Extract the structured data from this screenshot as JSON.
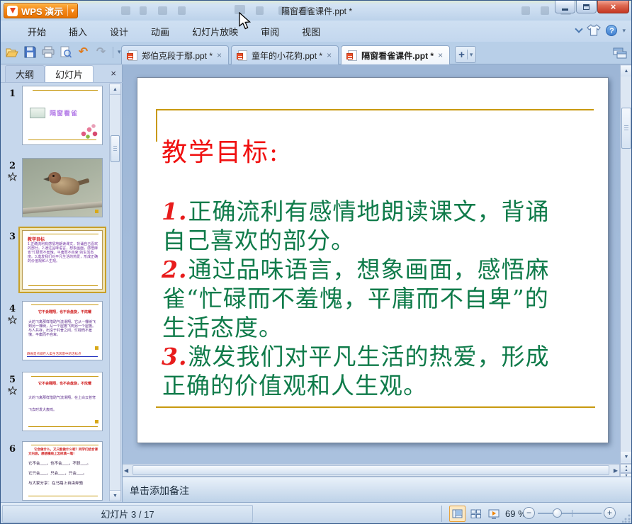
{
  "window": {
    "app_button_label": "WPS 演示",
    "title": "隔窗看雀课件.ppt *"
  },
  "menu": {
    "items": [
      "开始",
      "插入",
      "设计",
      "动画",
      "幻灯片放映",
      "审阅",
      "视图"
    ]
  },
  "doc_tabs": {
    "tabs": [
      {
        "label": "郑伯克段于鄢.ppt *"
      },
      {
        "label": "童年的小花狗.ppt *"
      },
      {
        "label": "隔窗看雀课件.ppt *"
      }
    ]
  },
  "sidebar": {
    "tab_outline": "大纲",
    "tab_slides": "幻灯片",
    "thumbnails": {
      "t1": {
        "num": "1",
        "title": "隔窗看雀"
      },
      "t2": {
        "num": "2"
      },
      "t3": {
        "num": "3",
        "heading": "教学目标",
        "body": "1.正确流利有感情地朗读课文，背诵自己喜欢的部分。2.通过品味语言，想象画面，感悟麻雀“忙碌而不羞愧，平庸而不自卑”的生活态度。3.激发我们对平凡生活的热爱，形成正确的价值观和人生观。"
      },
      "t4": {
        "num": "4",
        "lead": "它不会翱翔，也不会盘旋，不炫耀",
        "body": "大的飞禽那样借助气流滑翔。它从一棵树飞到另一棵树，从一个屋檐飞到另一个屋檐。与人共存，出没于村舍之间，忙碌而不羞愧，平庸而不自卑。",
        "footer": "麻雀是点缀在人类生活风景中的活标点"
      },
      "t5": {
        "num": "5",
        "lead": "它不会翱翔，也不会盘旋，不炫耀",
        "body1": "大的飞禽那样借助气流滑翔，在上白云苍穹",
        "body2": "飞去时发大轰鸣。"
      },
      "t6": {
        "num": "6",
        "lead": "它会做什么，又只能做什么呢？同学们结合课文内容，想想横线上怎样填一填！",
        "blank1": "它不会___，也不会___，不骄___。",
        "blank2": "它只会___，只会___，只会___。",
        "blank3": "与大家分享：在马路上自由奔驰"
      }
    }
  },
  "slide": {
    "title": "教学目标:",
    "lines": [
      {
        "num": "1.",
        "text": "正确流利有感情地朗读课文，背诵"
      },
      {
        "num": "",
        "text": "自己喜欢的部分。"
      },
      {
        "num": "2.",
        "text": "通过品味语言，想象画面，感悟麻"
      },
      {
        "num": "",
        "text": "雀“忙碌而不羞愧，平庸而不自卑”的"
      },
      {
        "num": "",
        "text": "生活态度。"
      },
      {
        "num": "3.",
        "text": "激发我们对平凡生活的热爱，形成"
      },
      {
        "num": "",
        "text": "正确的价值观和人生观。"
      }
    ]
  },
  "notes": {
    "placeholder": "单击添加备注"
  },
  "statusbar": {
    "slide_indicator": "幻灯片 3 / 17",
    "zoom_percent": "69 %"
  },
  "glyphs": {
    "close": "×",
    "caret": "▾",
    "plus": "+",
    "help": "?",
    "up": "▲",
    "down": "▼",
    "left": "◀",
    "right": "▶",
    "minus": "−",
    "undo": "↶",
    "redo": "↷"
  },
  "colors": {
    "accent_orange": "#f08300",
    "title_red": "#f01010",
    "body_green": "#0f7b4a",
    "gold": "#c8990f"
  }
}
